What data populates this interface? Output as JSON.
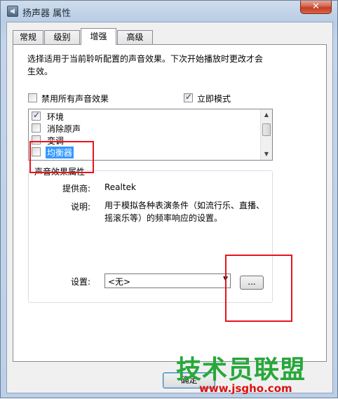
{
  "window": {
    "title": "扬声器 属性",
    "close_glyph": "✕"
  },
  "tabs": [
    {
      "label": "常规",
      "active": false
    },
    {
      "label": "级别",
      "active": false
    },
    {
      "label": "增强",
      "active": true
    },
    {
      "label": "高级",
      "active": false
    }
  ],
  "enhancements": {
    "description": "选择适用于当前聆听配置的声音效果。下次开始播放时更改才会生效。",
    "disable_all": {
      "label": "禁用所有声音效果",
      "checked": false
    },
    "immediate_mode": {
      "label": "立即模式",
      "checked": true
    },
    "effects": [
      {
        "label": "环境",
        "checked": true,
        "selected": false
      },
      {
        "label": "消除原声",
        "checked": false,
        "selected": false
      },
      {
        "label": "变调",
        "checked": false,
        "selected": false
      },
      {
        "label": "均衡器",
        "checked": false,
        "selected": true
      }
    ]
  },
  "properties": {
    "group_title": "声音效果属性",
    "provider_label": "提供商:",
    "provider_value": "Realtek",
    "description_label": "说明:",
    "description_value": "用于模拟各种表演条件（如流行乐、直播、摇滚乐等）的频率响应的设置。",
    "settings_label": "设置:",
    "settings_value": "<无>",
    "more_button": "..."
  },
  "buttons": {
    "ok": "确定"
  },
  "watermark": {
    "logo": "技术员联盟",
    "url": "www.jsgho.com"
  },
  "colors": {
    "highlight": "#3399ff",
    "annotation": "#e8141b",
    "watermark_green": "#27a83a"
  }
}
